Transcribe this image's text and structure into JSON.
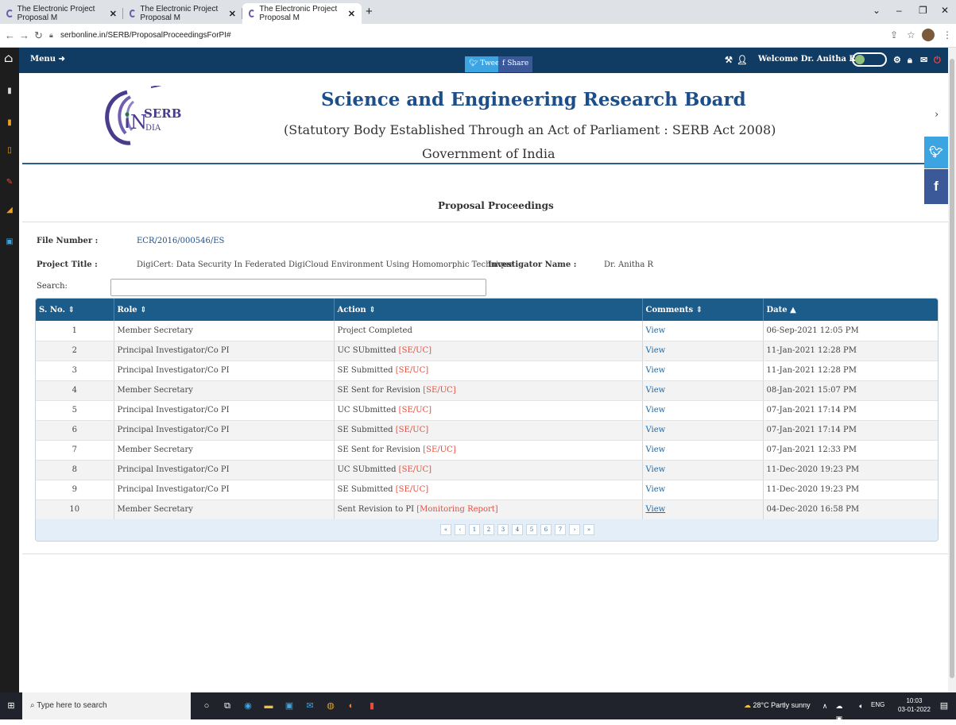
{
  "browser": {
    "tabs": [
      {
        "title": "The Electronic Project Proposal M"
      },
      {
        "title": "The Electronic Project Proposal M"
      },
      {
        "title": "The Electronic Project Proposal M"
      }
    ],
    "url": "serbonline.in/SERB/ProposalProceedingsForPI#"
  },
  "nav": {
    "menu_label": "Menu",
    "tweet_label": "Tweet",
    "share_label": "Share",
    "welcome": "Welcome Dr. Anitha R"
  },
  "header": {
    "logo_text": "SERB",
    "logo_sub": "DIA",
    "org_name": "Science and Engineering Research Board",
    "org_subtitle": "(Statutory Body Established Through an Act of Parliament : SERB Act 2008)",
    "gov": "Government of India",
    "page_title": "Proposal Proceedings"
  },
  "details": {
    "file_number_label": "File Number :",
    "file_number": "ECR/2016/000546/ES",
    "project_title_label": "Project Title :",
    "project_title": "DigiCert: Data Security In Federated DigiCloud Environment Using Homomorphic Technique",
    "investigator_label": "Investigator Name :",
    "investigator": "Dr. Anitha R",
    "search_label": "Search:"
  },
  "table": {
    "headers": [
      "S. No.",
      "Role",
      "Action",
      "Comments",
      "Date"
    ],
    "rows": [
      {
        "sn": "1",
        "role": "Member Secretary",
        "action": "Project Completed",
        "tag": "",
        "comment": "View",
        "date": "06-Sep-2021 12:05 PM"
      },
      {
        "sn": "2",
        "role": "Principal Investigator/Co PI",
        "action": "UC SUbmitted",
        "tag": "[SE/UC]",
        "comment": "View",
        "date": "11-Jan-2021 12:28 PM"
      },
      {
        "sn": "3",
        "role": "Principal Investigator/Co PI",
        "action": "SE Submitted",
        "tag": "[SE/UC]",
        "comment": "View",
        "date": "11-Jan-2021 12:28 PM"
      },
      {
        "sn": "4",
        "role": "Member Secretary",
        "action": "SE Sent for Revision",
        "tag": "[SE/UC]",
        "comment": "View",
        "date": "08-Jan-2021 15:07 PM"
      },
      {
        "sn": "5",
        "role": "Principal Investigator/Co PI",
        "action": "UC SUbmitted",
        "tag": "[SE/UC]",
        "comment": "View",
        "date": "07-Jan-2021 17:14 PM"
      },
      {
        "sn": "6",
        "role": "Principal Investigator/Co PI",
        "action": "SE Submitted",
        "tag": "[SE/UC]",
        "comment": "View",
        "date": "07-Jan-2021 17:14 PM"
      },
      {
        "sn": "7",
        "role": "Member Secretary",
        "action": "SE Sent for Revision",
        "tag": "[SE/UC]",
        "comment": "View",
        "date": "07-Jan-2021 12:33 PM"
      },
      {
        "sn": "8",
        "role": "Principal Investigator/Co PI",
        "action": "UC SUbmitted",
        "tag": "[SE/UC]",
        "comment": "View",
        "date": "11-Dec-2020 19:23 PM"
      },
      {
        "sn": "9",
        "role": "Principal Investigator/Co PI",
        "action": "SE Submitted",
        "tag": "[SE/UC]",
        "comment": "View",
        "date": "11-Dec-2020 19:23 PM"
      },
      {
        "sn": "10",
        "role": "Member Secretary",
        "action": "Sent Revision to PI",
        "tag": "[Monitoring Report]",
        "comment": "View",
        "date": "04-Dec-2020 16:58 PM"
      }
    ],
    "pages": [
      "«",
      "‹",
      "1",
      "2",
      "3",
      "4",
      "5",
      "6",
      "7",
      "›",
      "»"
    ]
  },
  "taskbar": {
    "search_placeholder": "Type here to search",
    "weather": "28°C  Partly sunny",
    "lang": "ENG",
    "time": "10:03",
    "date": "03-01-2022"
  }
}
